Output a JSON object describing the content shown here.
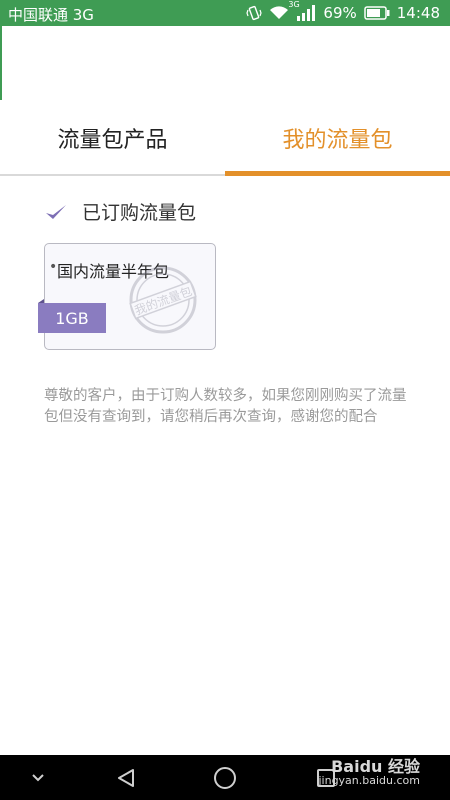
{
  "status_bar": {
    "carrier": "中国联通 3G",
    "network_badge": "3G",
    "battery": "69%",
    "time": "14:48"
  },
  "tabs": [
    {
      "label": "流量包产品",
      "active": false
    },
    {
      "label": "我的流量包",
      "active": true
    }
  ],
  "section": {
    "heading": "已订购流量包",
    "icon": "checkmark-icon"
  },
  "packages": [
    {
      "name": "国内流量半年包",
      "size": "1GB",
      "stamp_text": "我的流量包"
    }
  ],
  "notice": "尊敬的客户，由于订购人数较多，如果您刚刚购买了流量包但没有查询到，请您稍后再次查询，感谢您的配合",
  "nav_bar": {
    "buttons": [
      "chevron-down-icon",
      "back-icon",
      "home-icon",
      "recents-icon"
    ]
  },
  "watermark": {
    "brand": "Baidu 经验",
    "url": "jingyan.baidu.com"
  },
  "colors": {
    "status_bar": "#3f9c54",
    "accent": "#e3902a",
    "tag": "#8a7cc0",
    "notice_text": "#9a9a9a"
  }
}
